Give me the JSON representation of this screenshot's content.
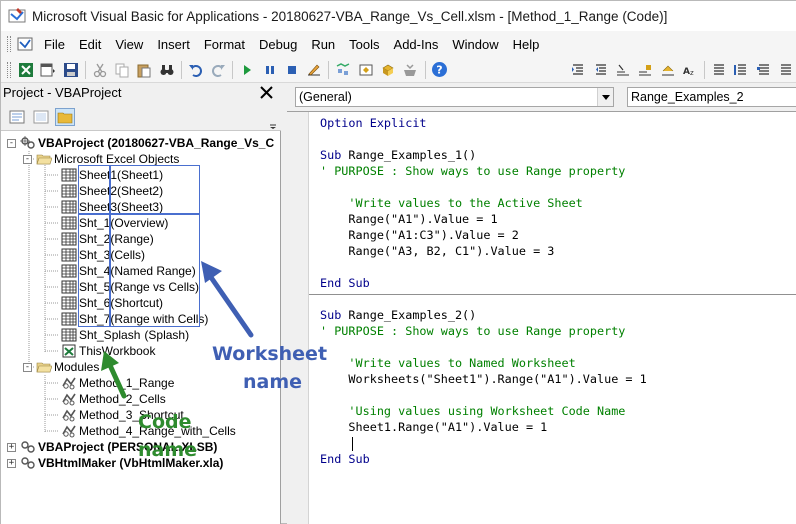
{
  "window": {
    "title": "Microsoft Visual Basic for Applications - 20180627-VBA_Range_Vs_Cell.xlsm - [Method_1_Range (Code)]"
  },
  "menubar": {
    "items": [
      "File",
      "Edit",
      "View",
      "Insert",
      "Format",
      "Debug",
      "Run",
      "Tools",
      "Add-Ins",
      "Window",
      "Help"
    ]
  },
  "toolbar": {
    "icons": [
      "excel-icon",
      "insert-module-icon",
      "save-icon",
      "cut-icon",
      "copy-icon",
      "paste-icon",
      "find-icon",
      "undo-icon",
      "redo-icon",
      "run-icon",
      "break-icon",
      "reset-icon",
      "design-mode-icon",
      "project-explorer-icon",
      "properties-icon",
      "object-browser-icon",
      "toolbox-icon",
      "help-icon",
      "indent-icon",
      "outdent-icon",
      "toggle-breakpoint-icon",
      "comment-block-icon",
      "uncomment-block-icon",
      "toggle-bookmark-icon",
      "complete-word-icon",
      "next-bookmark-icon",
      "prev-bookmark-icon",
      "clear-bookmarks-icon"
    ]
  },
  "project_explorer": {
    "title": "Project - VBAProject",
    "tree": [
      {
        "id": "vbaproject-main",
        "label": "VBAProject (20180627-VBA_Range_Vs_C",
        "bold": true,
        "toggle": "-",
        "icon": "project"
      },
      {
        "id": "folder-excel-objects",
        "label": "Microsoft Excel Objects",
        "toggle": "-",
        "icon": "folder"
      },
      {
        "id": "sheet1",
        "code": "Sheet1",
        "name": "(Sheet1)",
        "icon": "sheet"
      },
      {
        "id": "sheet2",
        "code": "Sheet2",
        "name": "(Sheet2)",
        "icon": "sheet"
      },
      {
        "id": "sheet3",
        "code": "Sheet3",
        "name": "(Sheet3)",
        "icon": "sheet"
      },
      {
        "id": "sht1",
        "code": "Sht_1",
        "name": "(Overview)",
        "icon": "sheet"
      },
      {
        "id": "sht2",
        "code": "Sht_2",
        "name": "(Range)",
        "icon": "sheet"
      },
      {
        "id": "sht3",
        "code": "Sht_3",
        "name": "(Cells)",
        "icon": "sheet"
      },
      {
        "id": "sht4",
        "code": "Sht_4",
        "name": "(Named Range)",
        "icon": "sheet"
      },
      {
        "id": "sht5",
        "code": "Sht_5",
        "name": "(Range vs Cells)",
        "icon": "sheet"
      },
      {
        "id": "sht6",
        "code": "Sht_6",
        "name": "(Shortcut)",
        "icon": "sheet"
      },
      {
        "id": "sht7",
        "code": "Sht_7",
        "name": "(Range with Cells)",
        "icon": "sheet"
      },
      {
        "id": "sht-splash",
        "code": "Sht_Splash",
        "name": "(Splash)",
        "icon": "sheet"
      },
      {
        "id": "thisworkbook",
        "code": "ThisWorkbook",
        "name": "",
        "icon": "workbook"
      },
      {
        "id": "folder-modules",
        "label": "Modules",
        "toggle": "-",
        "icon": "folder"
      },
      {
        "id": "method1",
        "label": "Method_1_Range",
        "icon": "module"
      },
      {
        "id": "method2",
        "label": "Method_2_Cells",
        "icon": "module"
      },
      {
        "id": "method3",
        "label": "Method_3_Shortcut",
        "icon": "module"
      },
      {
        "id": "method4",
        "label": "Method_4_Range_with_Cells",
        "icon": "module"
      },
      {
        "id": "vbaproject-personal",
        "label": "VBAProject (PERSONAL.XLSB)",
        "bold": true,
        "toggle": "+",
        "icon": "project"
      },
      {
        "id": "vbhtmlmaker",
        "label": "VBHtmlMaker (VbHtmlMaker.xla)",
        "bold": true,
        "toggle": "+",
        "icon": "project"
      }
    ]
  },
  "code_window": {
    "object_combo": "(General)",
    "procedure_combo": "Range_Examples_2",
    "lines": [
      {
        "text": "Option Explicit",
        "style": "kw"
      },
      {
        "text": "",
        "style": "tx"
      },
      {
        "text": "Sub Range_Examples_1()",
        "style": "mixed",
        "kw": "Sub",
        "rest": " Range_Examples_1()"
      },
      {
        "text": "' PURPOSE : Show ways to use Range property",
        "style": "cm"
      },
      {
        "text": "",
        "style": "tx"
      },
      {
        "text": "    'Write values to the Active Sheet",
        "style": "cm"
      },
      {
        "text": "    Range(\"A1\").Value = 1",
        "style": "tx"
      },
      {
        "text": "    Range(\"A1:C3\").Value = 2",
        "style": "tx"
      },
      {
        "text": "    Range(\"A3, B2, C1\").Value = 3",
        "style": "tx"
      },
      {
        "text": "",
        "style": "tx"
      },
      {
        "text": "End Sub",
        "style": "kw"
      },
      {
        "text": "",
        "style": "tx"
      },
      {
        "text": "Sub Range_Examples_2()",
        "style": "mixed",
        "kw": "Sub",
        "rest": " Range_Examples_2()"
      },
      {
        "text": "' PURPOSE : Show ways to use Range property",
        "style": "cm"
      },
      {
        "text": "",
        "style": "tx"
      },
      {
        "text": "    'Write values to Named Worksheet",
        "style": "cm"
      },
      {
        "text": "    Worksheets(\"Sheet1\").Range(\"A1\").Value = 1",
        "style": "tx"
      },
      {
        "text": "",
        "style": "tx"
      },
      {
        "text": "    'Using values using Worksheet Code Name",
        "style": "cm"
      },
      {
        "text": "    Sheet1.Range(\"A1\").Value = 1",
        "style": "tx"
      },
      {
        "text": "",
        "style": "tx"
      },
      {
        "text": "End Sub",
        "style": "kw"
      }
    ]
  },
  "annotations": {
    "worksheet_name": [
      "Worksheet",
      "name"
    ],
    "code_name": [
      "Code",
      "name"
    ],
    "blue": "#3f5fb3",
    "green": "#2e8b2e"
  }
}
